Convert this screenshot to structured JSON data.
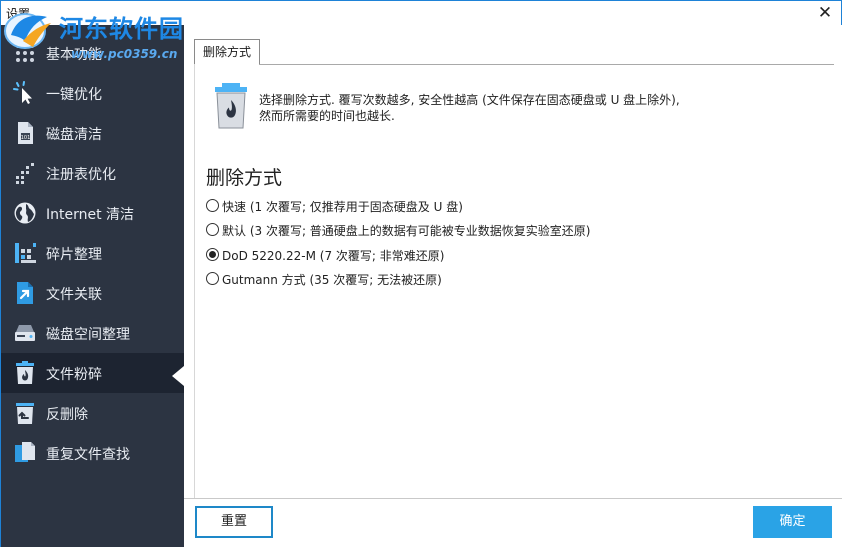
{
  "window": {
    "title": "设置",
    "close_glyph": "✕"
  },
  "watermark": {
    "site_name": "河东软件园",
    "url": "www.pc0359.cn"
  },
  "sidebar": {
    "items": [
      {
        "label": "基本功能",
        "icon": "grid-dots-icon"
      },
      {
        "label": "一键优化",
        "icon": "cursor-sparkle-icon"
      },
      {
        "label": "磁盘清洁",
        "icon": "disk-file-icon"
      },
      {
        "label": "注册表优化",
        "icon": "registry-dots-icon"
      },
      {
        "label": "Internet 清洁",
        "icon": "globe-icon"
      },
      {
        "label": "碎片整理",
        "icon": "defrag-bars-icon"
      },
      {
        "label": "文件关联",
        "icon": "file-link-icon"
      },
      {
        "label": "磁盘空间整理",
        "icon": "hard-drive-icon"
      },
      {
        "label": "文件粉碎",
        "icon": "trash-fire-icon",
        "active": true
      },
      {
        "label": "反删除",
        "icon": "undo-delete-icon"
      },
      {
        "label": "重复文件查找",
        "icon": "duplicate-files-icon"
      }
    ]
  },
  "main": {
    "tab_label": "删除方式",
    "info_line1": "选择删除方式. 覆写次数越多, 安全性越高 (文件保存在固态硬盘或 U 盘上除外),",
    "info_line2": "然而所需要的时间也越长.",
    "section_title": "删除方式",
    "options": [
      {
        "label": "快速 (1 次覆写; 仅推荐用于固态硬盘及 U 盘)",
        "checked": false
      },
      {
        "label": "默认 (3 次覆写; 普通硬盘上的数据有可能被专业数据恢复实验室还原)",
        "checked": false
      },
      {
        "label": "DoD 5220.22-M (7 次覆写; 非常难还原)",
        "checked": true
      },
      {
        "label": "Gutmann 方式 (35 次覆写; 无法被还原)",
        "checked": false
      }
    ]
  },
  "footer": {
    "reset_label": "重置",
    "ok_label": "确定"
  },
  "colors": {
    "sidebar_bg": "#2c3442",
    "sidebar_active_bg": "#1d2431",
    "accent": "#2aa3e6",
    "window_border": "#1e82d7"
  }
}
